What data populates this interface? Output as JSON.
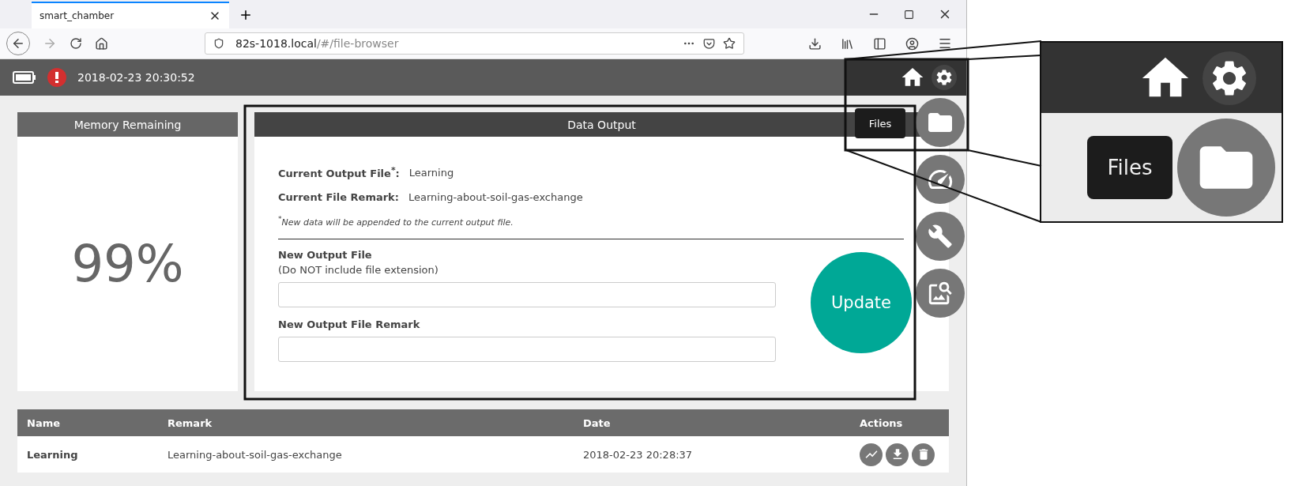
{
  "browser": {
    "tab_title": "smart_chamber",
    "url_host": "82s-1018.local",
    "url_path": "/#/file-browser"
  },
  "header": {
    "datetime": "2018-02-23 20:30:52",
    "alert": true
  },
  "memory": {
    "title": "Memory Remaining",
    "value": "99%"
  },
  "data_output": {
    "title": "Data Output",
    "current_file_label": "Current Output File$^{*}$:",
    "current_file": "Learning",
    "remark_label": "Current File Remark:",
    "remark": "Learning-about-soil-gas-exchange",
    "note": "$^{*}$New data will be appended to the current output file.",
    "fields": [
      {
        "label": "New Output File",
        "hint": "(Do NOT include file extension)"
      },
      {
        "label": "New Output File Remark"
      }
    ],
    "button": "Update"
  },
  "nav": {
    "tooltip": "Files",
    "items": [
      {
        "kind": "folder"
      },
      {
        "kind": "gauge"
      },
      {
        "kind": "wrench"
      },
      {
        "kind": "search"
      }
    ]
  },
  "table": {
    "columns": [
      "Name",
      "Remark",
      "Date",
      "Actions"
    ],
    "rows": [
      {
        "name": "Learning",
        "remark": "Learning-about-soil-gas-exchange",
        "date": "2018-02-23 20:28:37"
      }
    ]
  },
  "inset": {
    "tooltip": "Files"
  }
}
